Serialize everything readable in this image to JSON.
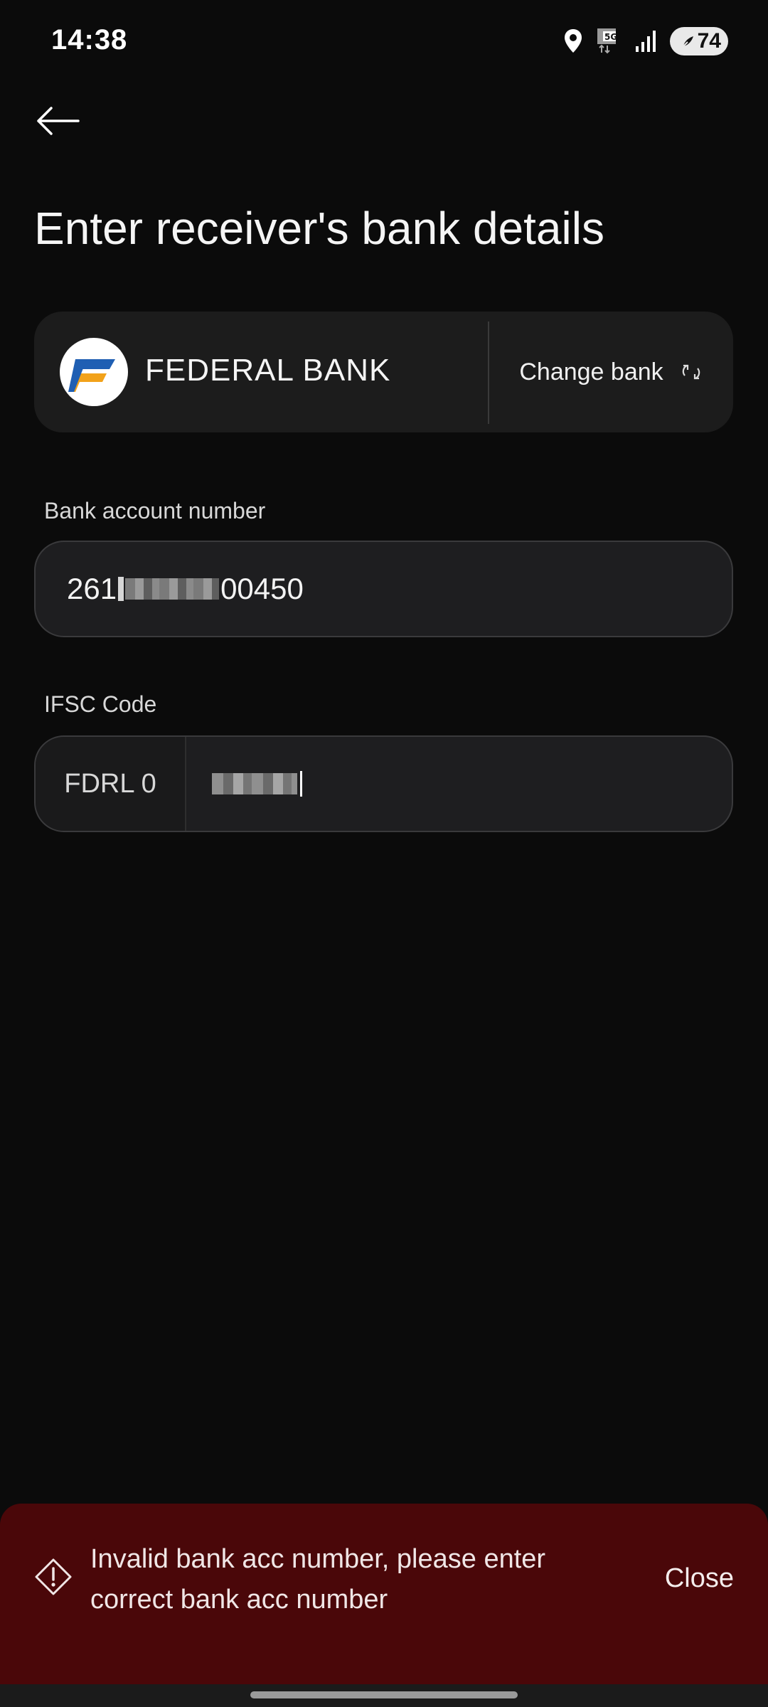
{
  "status_bar": {
    "time": "14:38",
    "network": "5G",
    "battery": "74"
  },
  "header": {
    "back_icon": "arrow-left-icon",
    "title": "Enter receiver's bank details"
  },
  "bank": {
    "name": "FEDERAL BANK",
    "logo_letter": "F",
    "change_label": "Change bank",
    "change_icon": "refresh-icon"
  },
  "account_field": {
    "label": "Bank account number",
    "value_prefix": "261",
    "value_suffix": "00450"
  },
  "ifsc_field": {
    "label": "IFSC Code",
    "prefix": "FDRL 0"
  },
  "error_snackbar": {
    "icon": "warning-icon",
    "message": "Invalid bank acc number, please enter correct bank acc number",
    "close_label": "Close",
    "background": "#4a0709"
  }
}
